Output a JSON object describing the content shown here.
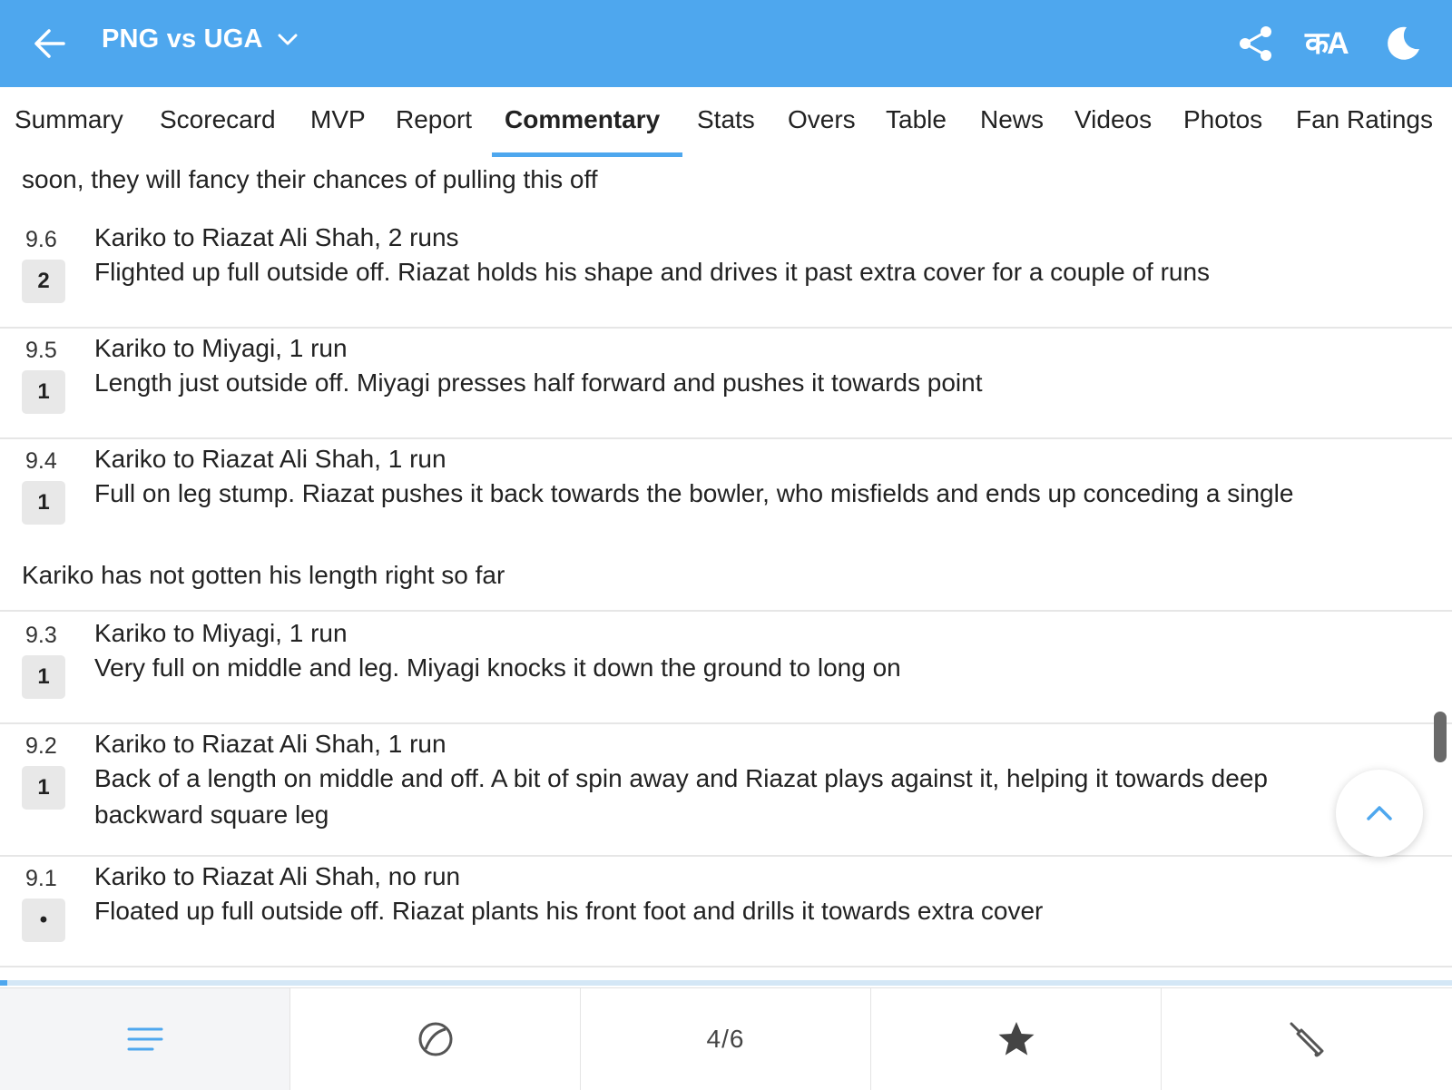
{
  "header": {
    "title": "PNG vs UGA",
    "back_icon": "arrow-left-icon",
    "dropdown_icon": "chevron-down-icon",
    "share_icon": "share-icon",
    "language_label": "कA",
    "theme_icon": "moon-icon",
    "background_color": "#4ea7ee"
  },
  "tabs": [
    {
      "label": "Summary"
    },
    {
      "label": "Scorecard"
    },
    {
      "label": "MVP"
    },
    {
      "label": "Report"
    },
    {
      "label": "Commentary",
      "active": true
    },
    {
      "label": "Stats"
    },
    {
      "label": "Overs"
    },
    {
      "label": "Table"
    },
    {
      "label": "News"
    },
    {
      "label": "Videos"
    },
    {
      "label": "Photos"
    },
    {
      "label": "Fan Ratings"
    }
  ],
  "commentary": {
    "intro_text": "soon, they will fancy their chances of pulling this off",
    "note_text": "Kariko has not gotten his length right so far",
    "balls": [
      {
        "over": "9.6",
        "runs": "2",
        "headline": "Kariko to Riazat Ali Shah, 2 runs",
        "description": "Flighted up full outside off. Riazat holds his shape and drives it past extra cover for a couple of runs"
      },
      {
        "over": "9.5",
        "runs": "1",
        "headline": "Kariko to Miyagi, 1 run",
        "description": "Length just outside off. Miyagi presses half forward and pushes it towards point"
      },
      {
        "over": "9.4",
        "runs": "1",
        "headline": "Kariko to Riazat Ali Shah, 1 run",
        "description": "Full on leg stump. Riazat pushes it back towards the bowler, who misfields and ends up conceding a single"
      },
      {
        "over": "9.3",
        "runs": "1",
        "headline": "Kariko to Miyagi, 1 run",
        "description": "Very full on middle and leg. Miyagi knocks it down the ground to long on"
      },
      {
        "over": "9.2",
        "runs": "1",
        "headline": "Kariko to Riazat Ali Shah, 1 run",
        "description": "Back of a length on middle and off. A bit of spin away and Riazat plays against it, helping it towards deep backward square leg"
      },
      {
        "over": "9.1",
        "runs": "•",
        "headline": "Kariko to Riazat Ali Shah, no run",
        "description": "Floated up full outside off. Riazat plants his front foot and drills it towards extra cover"
      }
    ]
  },
  "scroll_top_icon": "chevron-up-icon",
  "bottom_nav": {
    "items": [
      {
        "icon": "menu-lines-icon",
        "active": true
      },
      {
        "icon": "ball-icon"
      },
      {
        "label": "4/6"
      },
      {
        "icon": "star-icon"
      },
      {
        "icon": "cricket-bat-icon"
      }
    ]
  },
  "progress": 0.005,
  "accent_color": "#4ea7ee"
}
